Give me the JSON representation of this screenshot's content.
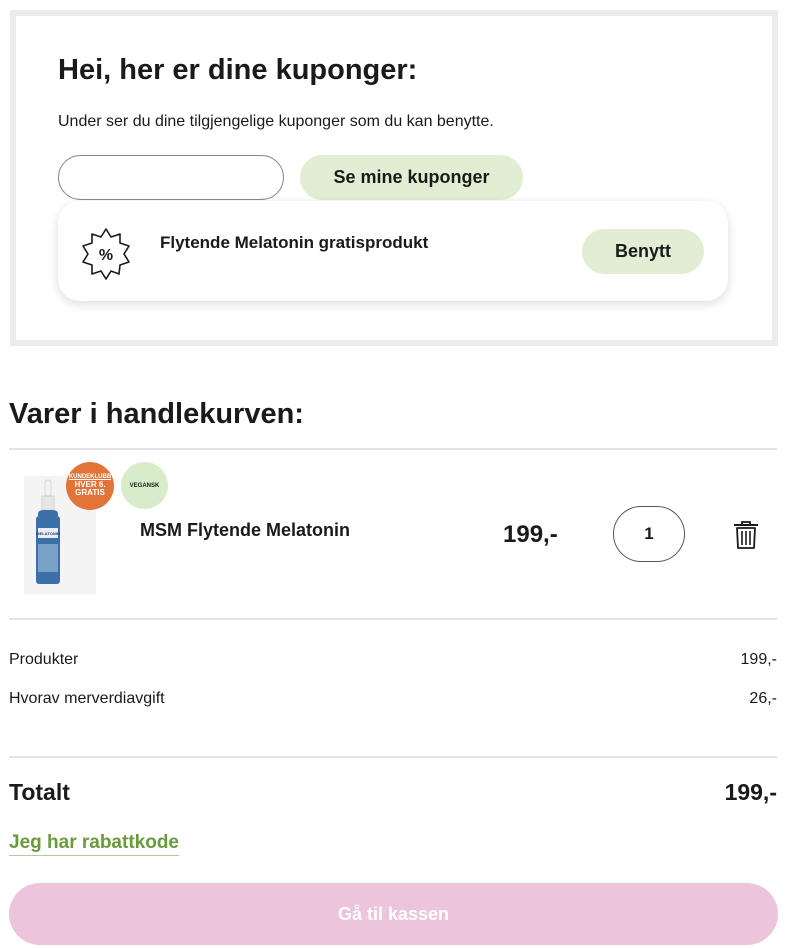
{
  "coupons": {
    "title": "Hei, her er dine kuponger:",
    "description": "Under ser du dine tilgjengelige kuponger som du kan benytte.",
    "input_value": "",
    "button_label": "Se mine kuponger",
    "items": [
      {
        "name": "Flytende Melatonin gratisprodukt",
        "icon": "percent-badge-icon",
        "action_label": "Benytt"
      }
    ]
  },
  "cart": {
    "heading": "Varer i handlekurven:",
    "items": [
      {
        "badges": {
          "club_top": "KUNDEKLUBB",
          "club_line1": "HVER 6.",
          "club_line2": "GRATIS",
          "vegan": "VEGANSK"
        },
        "name": "MSM Flytende Melatonin",
        "price": "199,-",
        "quantity": "1"
      }
    ]
  },
  "summary": {
    "products_label": "Produkter",
    "products_value": "199,-",
    "vat_label": "Hvorav merverdiavgift",
    "vat_value": "26,-",
    "total_label": "Totalt",
    "total_value": "199,-"
  },
  "discount_link": "Jeg har rabattkode",
  "checkout_label": "Gå til kassen",
  "colors": {
    "light_green": "#e1eed4",
    "link_green": "#6a9b3a",
    "checkout_pink": "#ecc4dc",
    "club_orange": "#e2743a",
    "vegan_green": "#d8ecca"
  }
}
